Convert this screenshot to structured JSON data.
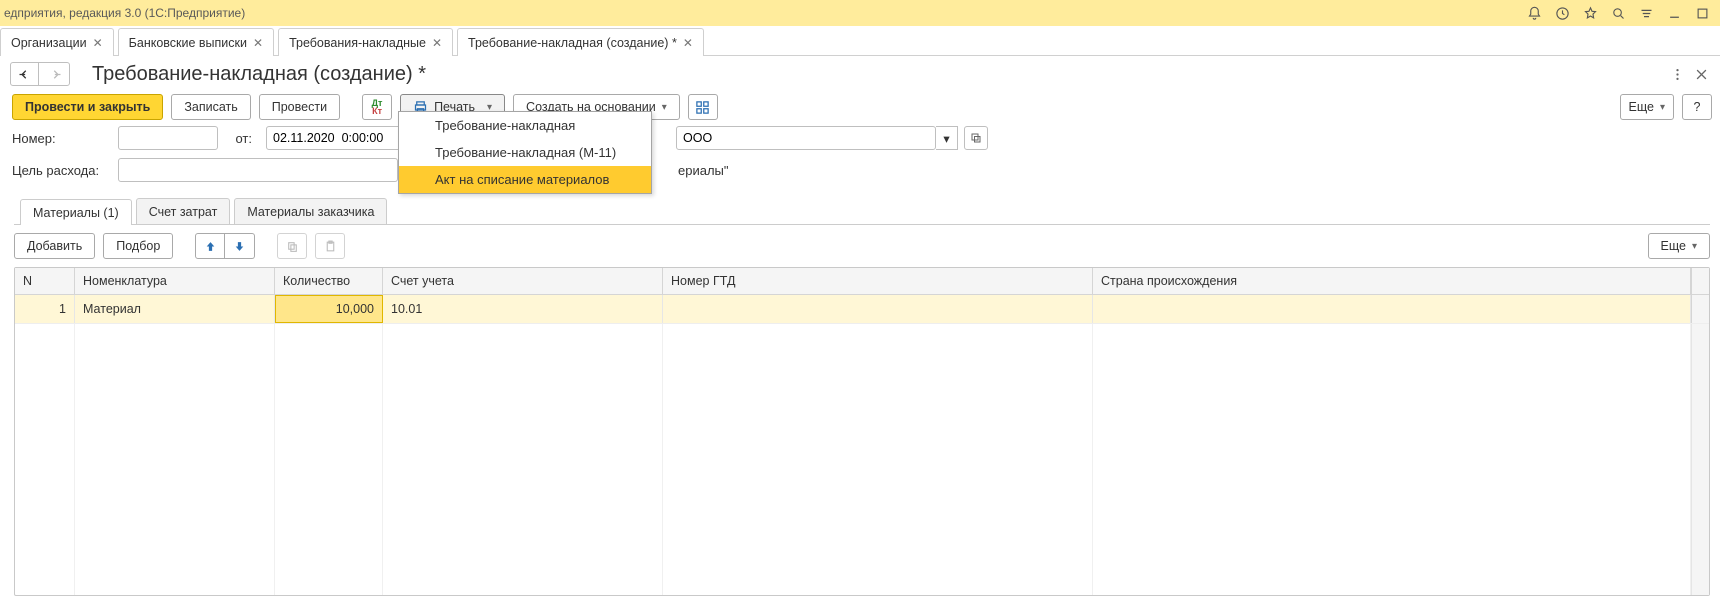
{
  "window": {
    "title": "едприятия, редакция 3.0  (1С:Предприятие)"
  },
  "tabs": [
    {
      "label": "Организации"
    },
    {
      "label": "Банковские выписки"
    },
    {
      "label": "Требования-накладные"
    },
    {
      "label": "Требование-накладная (создание) *",
      "active": true
    }
  ],
  "page": {
    "title": "Требование-накладная (создание) *"
  },
  "toolbar": {
    "post_close": "Провести и закрыть",
    "write": "Записать",
    "post": "Провести",
    "print": "Печать",
    "create_based": "Создать на основании",
    "more": "Еще"
  },
  "print_menu": {
    "items": [
      "Требование-накладная",
      "Требование-накладная (М-11)",
      "Акт на списание материалов"
    ],
    "highlight_index": 2
  },
  "form": {
    "number_label": "Номер:",
    "number_value": "",
    "from_label": "от:",
    "date_value": "02.11.2020  0:00:00",
    "org_partial_value": "ООО",
    "purpose_label": "Цель расхода:",
    "purpose_value": "",
    "purpose_partial_text": "ериалы\""
  },
  "sub_tabs": [
    {
      "label": "Материалы (1)",
      "active": true
    },
    {
      "label": "Счет затрат"
    },
    {
      "label": "Материалы заказчика"
    }
  ],
  "table_toolbar": {
    "add": "Добавить",
    "pick": "Подбор",
    "more": "Еще"
  },
  "table": {
    "columns": [
      "N",
      "Номенклатура",
      "Количество",
      "Счет учета",
      "Номер ГТД",
      "Страна происхождения"
    ],
    "rows": [
      {
        "n": "1",
        "nomenclature": "Материал",
        "qty": "10,000",
        "account": "10.01",
        "gtd": "",
        "country": ""
      }
    ]
  }
}
